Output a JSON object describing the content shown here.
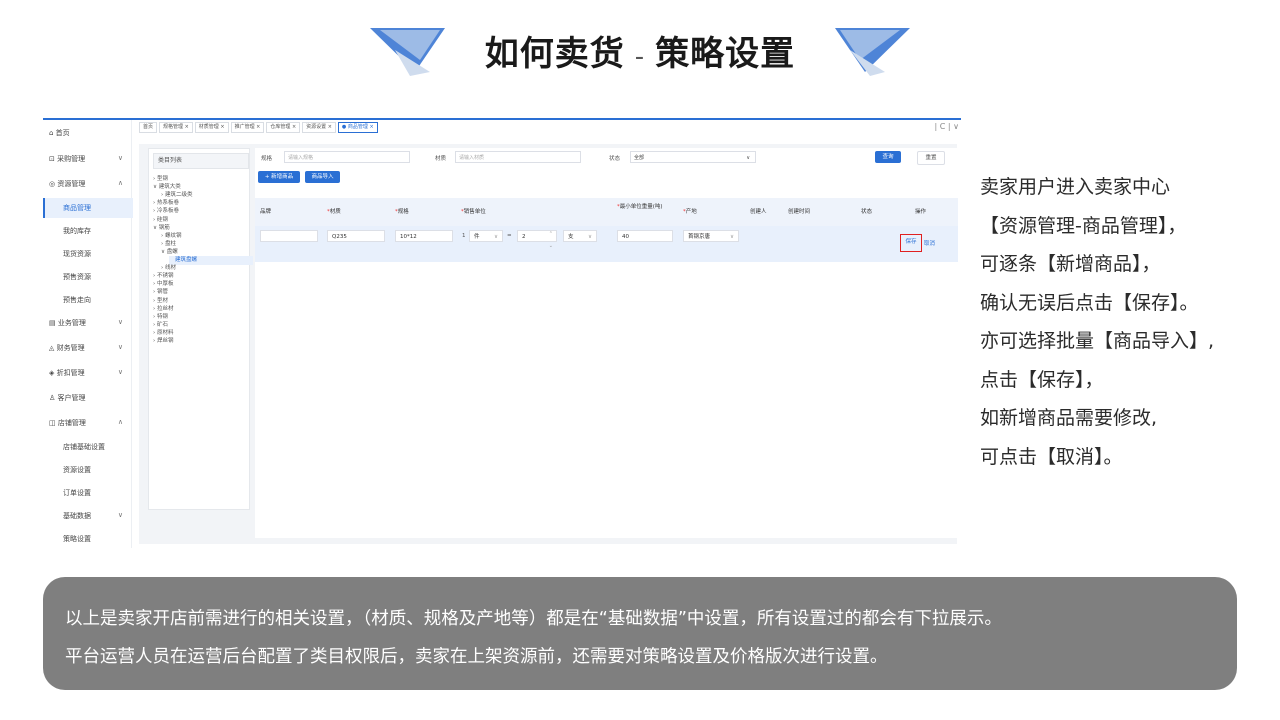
{
  "slide": {
    "title_left": "如何卖货",
    "title_dash": "-",
    "title_right": "策略设置"
  },
  "app": {
    "nav": [
      {
        "label": "首页",
        "icon": "home-icon",
        "chevron": ""
      },
      {
        "label": "采购管理",
        "icon": "cart-icon",
        "chevron": "∨"
      },
      {
        "label": "资源管理",
        "icon": "resource-icon",
        "chevron": "∧"
      },
      {
        "label": "业务管理",
        "icon": "business-icon",
        "chevron": "∨"
      },
      {
        "label": "财务管理",
        "icon": "finance-icon",
        "chevron": "∨"
      },
      {
        "label": "折扣管理",
        "icon": "discount-icon",
        "chevron": "∨"
      },
      {
        "label": "客户管理",
        "icon": "customer-icon",
        "chevron": ""
      },
      {
        "label": "店铺管理",
        "icon": "shop-icon",
        "chevron": "∧"
      }
    ],
    "nav_sub_resource": [
      "商品管理",
      "我的库存",
      "现货资源",
      "预售资源",
      "预售走向"
    ],
    "nav_sub_shop": [
      "店铺基础设置",
      "资源设置",
      "订单设置",
      "基础数据",
      "策略设置"
    ],
    "nav_sub_shop_chevron": "∨",
    "tabs": [
      "首页",
      "规格管理 ×",
      "材质管理 ×",
      "推广管理 ×",
      "仓库管理 ×",
      "资源设置 ×",
      "● 商品管理 ×"
    ],
    "refresh_glyphs": "| C | ∨",
    "category_header": "类目列表",
    "categories": [
      {
        "label": "› 型钢",
        "indent": 0
      },
      {
        "label": "∨ 建筑大类",
        "indent": 0
      },
      {
        "label": "› 建筑二级类",
        "indent": 1
      },
      {
        "label": "› 热系板卷",
        "indent": 0
      },
      {
        "label": "› 冷系板卷",
        "indent": 0
      },
      {
        "label": "› 硅钢",
        "indent": 0
      },
      {
        "label": "∨ 钢筋",
        "indent": 0
      },
      {
        "label": "› 螺纹钢",
        "indent": 1
      },
      {
        "label": "› 盘柱",
        "indent": 1
      },
      {
        "label": "∨ 盘螺",
        "indent": 1
      },
      {
        "label": "建筑盘螺",
        "indent": 2,
        "selected": true
      },
      {
        "label": "› 线材",
        "indent": 1
      },
      {
        "label": "› 不锈钢",
        "indent": 0
      },
      {
        "label": "› 中厚板",
        "indent": 0
      },
      {
        "label": "› 钢管",
        "indent": 0
      },
      {
        "label": "› 型材",
        "indent": 0
      },
      {
        "label": "› 拉丝材",
        "indent": 0
      },
      {
        "label": "› 特钢",
        "indent": 0
      },
      {
        "label": "› 矿石",
        "indent": 0
      },
      {
        "label": "› 原材料",
        "indent": 0
      },
      {
        "label": "› 焊丝钢",
        "indent": 0
      }
    ],
    "filters": {
      "spec_label": "规格",
      "spec_placeholder": "请输入规格",
      "material_label": "材质",
      "material_placeholder": "请输入材质",
      "status_label": "状态",
      "status_value": "全部",
      "query_button": "查询",
      "reset_button": "重置"
    },
    "actions": {
      "add_button": "+ 新增商品",
      "import_button": "商品导入"
    },
    "table_headers": [
      {
        "label": "品牌",
        "required": false
      },
      {
        "label": "材质",
        "required": true
      },
      {
        "label": "规格",
        "required": true
      },
      {
        "label": "销售单位",
        "required": true
      },
      {
        "label": "最小单位重量(吨)",
        "required": true
      },
      {
        "label": "产地",
        "required": true
      },
      {
        "label": "创建人",
        "required": false
      },
      {
        "label": "创建时间",
        "required": false
      },
      {
        "label": "状态",
        "required": false
      },
      {
        "label": "操作",
        "required": false
      }
    ],
    "row": {
      "brand": "",
      "material": "Q235",
      "spec": "10*12",
      "unit_qty": "1",
      "unit_name": "件",
      "unit_eq": "=",
      "unit_count": "2",
      "unit_sub": "支",
      "min_weight": "40",
      "origin": "首钢京唐",
      "save": "保存",
      "cancel": "取消"
    }
  },
  "explain": [
    "卖家用户进入卖家中心",
    "【资源管理-商品管理】，",
    "可逐条【新增商品】，",
    "确认无误后点击【保存】。",
    "亦可选择批量【商品导入】,",
    "点击【保存】，",
    "如新增商品需要修改,",
    "可点击【取消】。"
  ],
  "note": [
    "以上是卖家开店前需进行的相关设置，（材质、规格及产地等）都是在“基础数据”中设置，所有设置过的都会有下拉展示。",
    "平台运营人员在运营后台配置了类目权限后，卖家在上架资源前，还需要对策略设置及价格版次进行设置。"
  ],
  "colors": {
    "accent": "#2a6fd4",
    "highlight": "#e02020",
    "note_bg": "#7f7f7f"
  }
}
